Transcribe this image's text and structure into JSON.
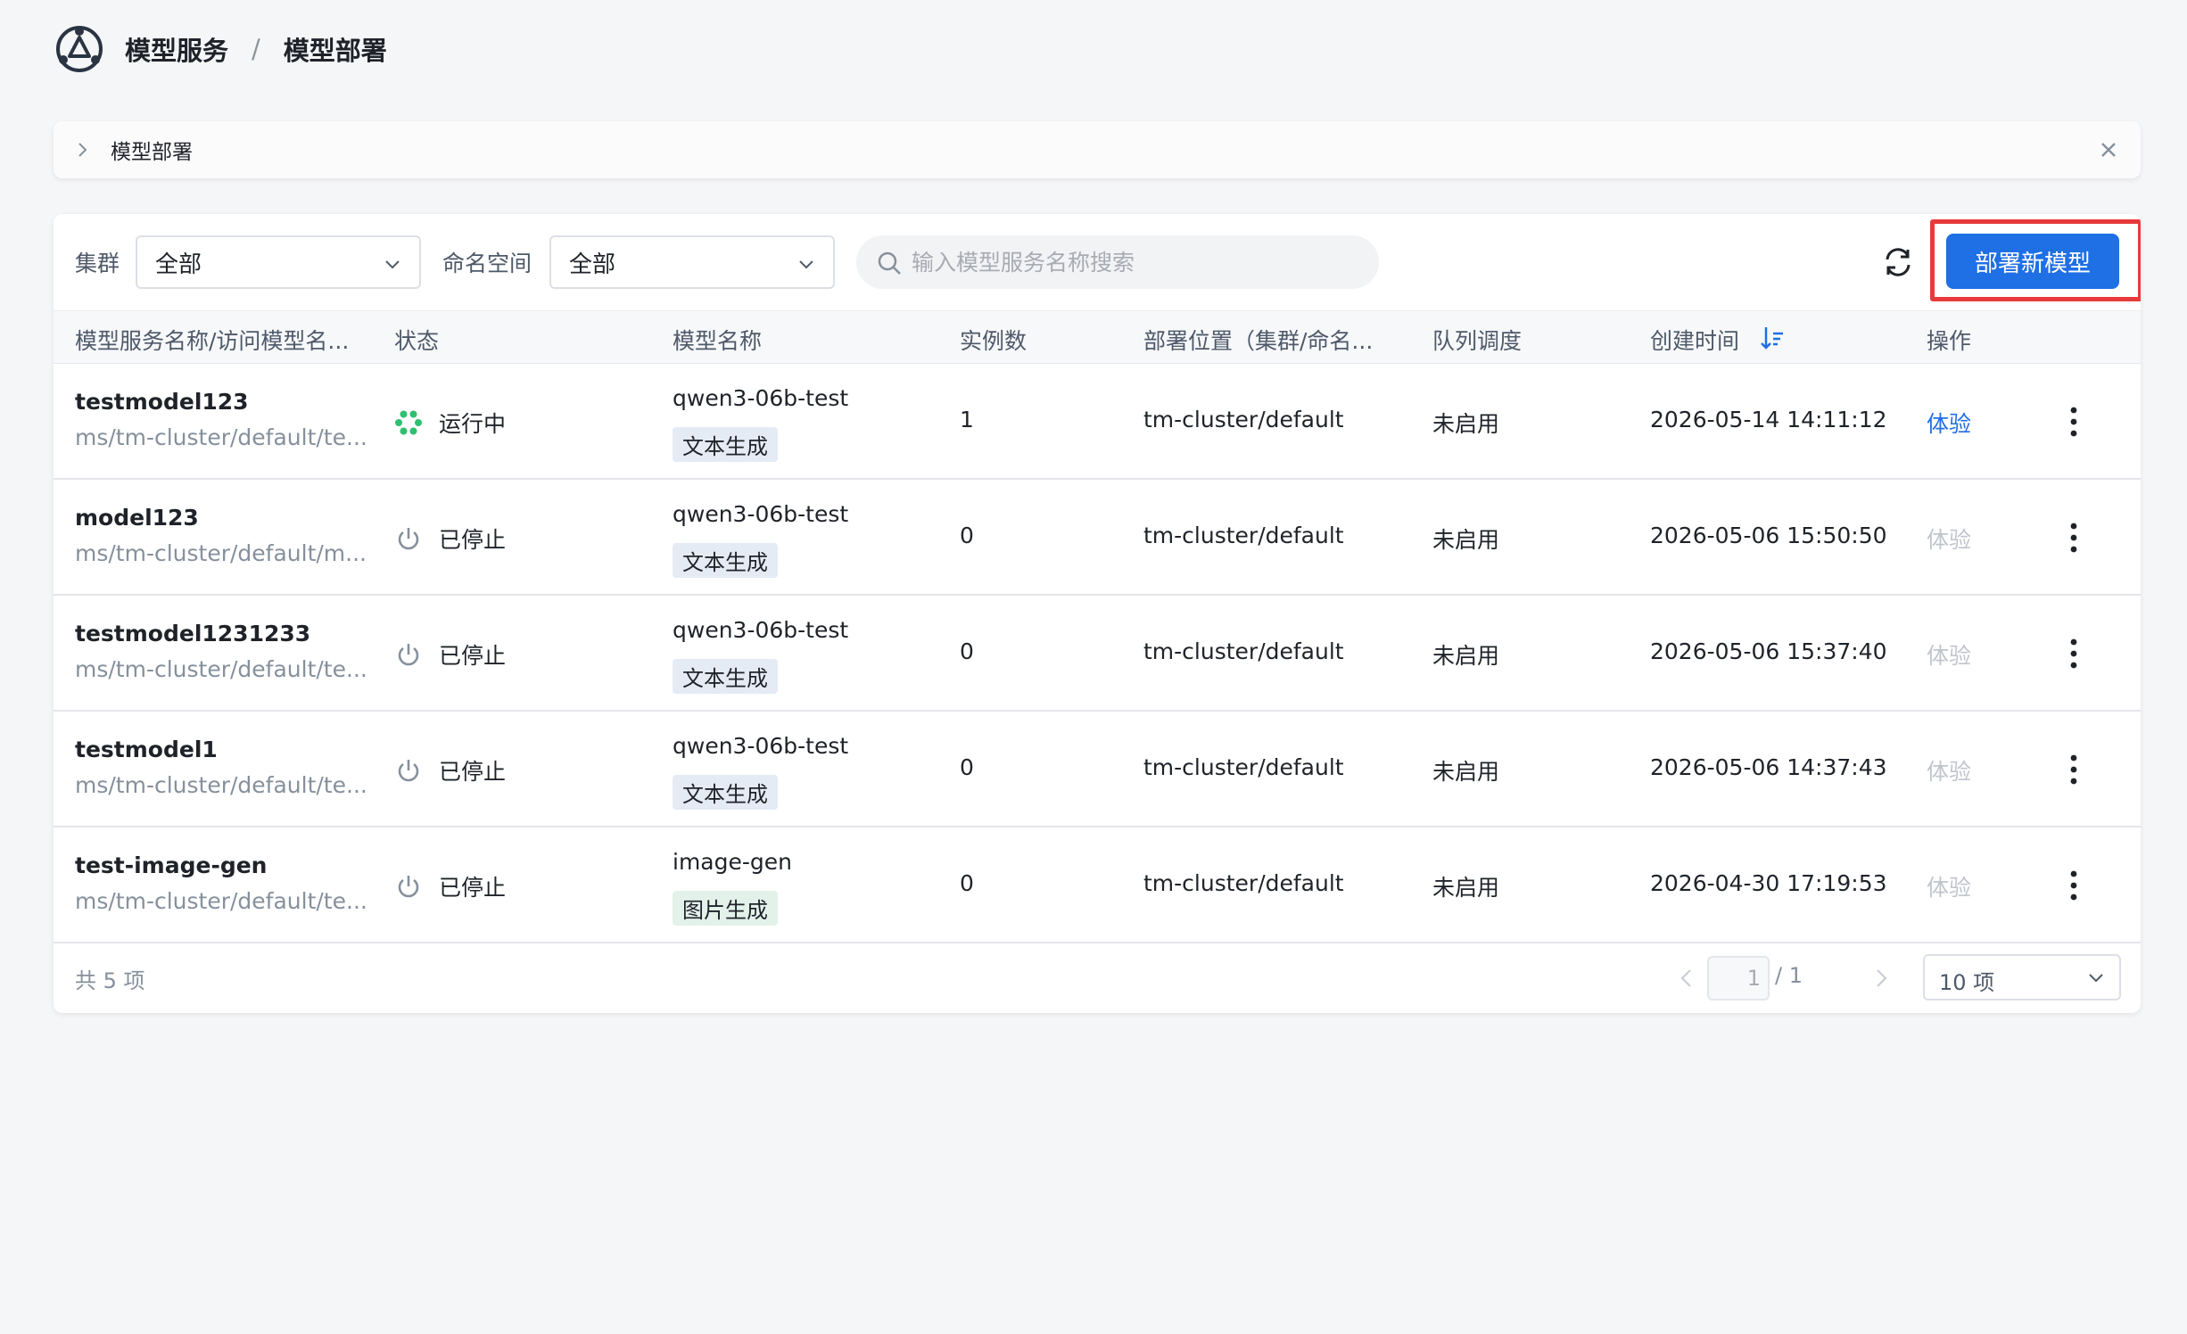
{
  "header": {
    "breadcrumb": [
      "模型服务",
      "模型部署"
    ],
    "separator": "/"
  },
  "notice": {
    "title": "模型部署"
  },
  "toolbar": {
    "cluster_label": "集群",
    "cluster_value": "全部",
    "namespace_label": "命名空间",
    "namespace_value": "全部",
    "search_placeholder": "输入模型服务名称搜索",
    "deploy_button": "部署新模型"
  },
  "table": {
    "columns": [
      "模型服务名称/访问模型名...",
      "状态",
      "模型名称",
      "实例数",
      "部署位置（集群/命名...",
      "队列调度",
      "创建时间",
      "操作"
    ],
    "rows": [
      {
        "name": "testmodel123",
        "path": "ms/tm-cluster/default/te...",
        "status": "运行中",
        "status_icon": "running-icon",
        "model": "qwen3-06b-test",
        "tag": "文本生成",
        "instances": "1",
        "location": "tm-cluster/default",
        "queue": "未启用",
        "created": "2026-05-14 14:11:12",
        "action": "体验",
        "action_enabled": true
      },
      {
        "name": "model123",
        "path": "ms/tm-cluster/default/m...",
        "status": "已停止",
        "status_icon": "power-icon",
        "model": "qwen3-06b-test",
        "tag": "文本生成",
        "instances": "0",
        "location": "tm-cluster/default",
        "queue": "未启用",
        "created": "2026-05-06 15:50:50",
        "action": "体验",
        "action_enabled": false
      },
      {
        "name": "testmodel1231233",
        "path": "ms/tm-cluster/default/te...",
        "status": "已停止",
        "status_icon": "power-icon",
        "model": "qwen3-06b-test",
        "tag": "文本生成",
        "instances": "0",
        "location": "tm-cluster/default",
        "queue": "未启用",
        "created": "2026-05-06 15:37:40",
        "action": "体验",
        "action_enabled": false
      },
      {
        "name": "testmodel1",
        "path": "ms/tm-cluster/default/te...",
        "status": "已停止",
        "status_icon": "power-icon",
        "model": "qwen3-06b-test",
        "tag": "文本生成",
        "instances": "0",
        "location": "tm-cluster/default",
        "queue": "未启用",
        "created": "2026-05-06 14:37:43",
        "action": "体验",
        "action_enabled": false
      },
      {
        "name": "test-image-gen",
        "path": "ms/tm-cluster/default/te...",
        "status": "已停止",
        "status_icon": "power-icon",
        "model": "image-gen",
        "tag": "图片生成",
        "instances": "0",
        "location": "tm-cluster/default",
        "queue": "未启用",
        "created": "2026-04-30 17:19:53",
        "action": "体验",
        "action_enabled": false
      }
    ]
  },
  "footer": {
    "total": "共 5 项",
    "page_current": "1",
    "page_total": "/ 1",
    "page_size": "10 项"
  },
  "colors": {
    "primary": "#1f6fe5",
    "highlight": "#e83a3a",
    "running": "#2fbf71",
    "text_tag_bg": "#e4ebf5",
    "image_tag_bg": "#e2f1ea"
  }
}
